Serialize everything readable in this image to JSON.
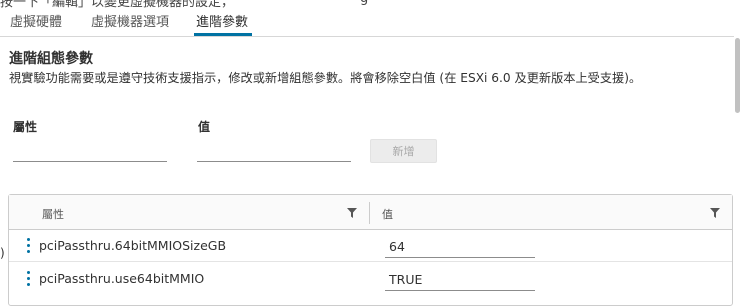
{
  "top_clipped": {
    "text": "按一下「編輯」以變更虛擬機器的設定，",
    "tail": "g"
  },
  "tabs": [
    {
      "label": "虛擬硬體",
      "active": false
    },
    {
      "label": "虛擬機器選項",
      "active": false
    },
    {
      "label": "進階參數",
      "active": true
    }
  ],
  "section": {
    "title": "進階組態參數",
    "description": "視實驗功能需要或是遵守技術支援指示，修改或新增組態參數。將會移除空白值 (在 ESXi 6.0 及更新版本上受支援)。"
  },
  "form": {
    "attribute_label": "屬性",
    "value_label": "值",
    "attribute_value": "",
    "value_value": "",
    "add_label": "新增"
  },
  "grid": {
    "columns": [
      "屬性",
      "值"
    ],
    "rows": [
      {
        "attribute": "pciPassthru.64bitMMIOSizeGB",
        "value": "64"
      },
      {
        "attribute": "pciPassthru.use64bitMMIO",
        "value": "TRUE"
      }
    ]
  },
  "left_mark": ")",
  "colors": {
    "accent": "#0072a3",
    "border": "#cccccc",
    "disabled_button": "#ececec"
  }
}
